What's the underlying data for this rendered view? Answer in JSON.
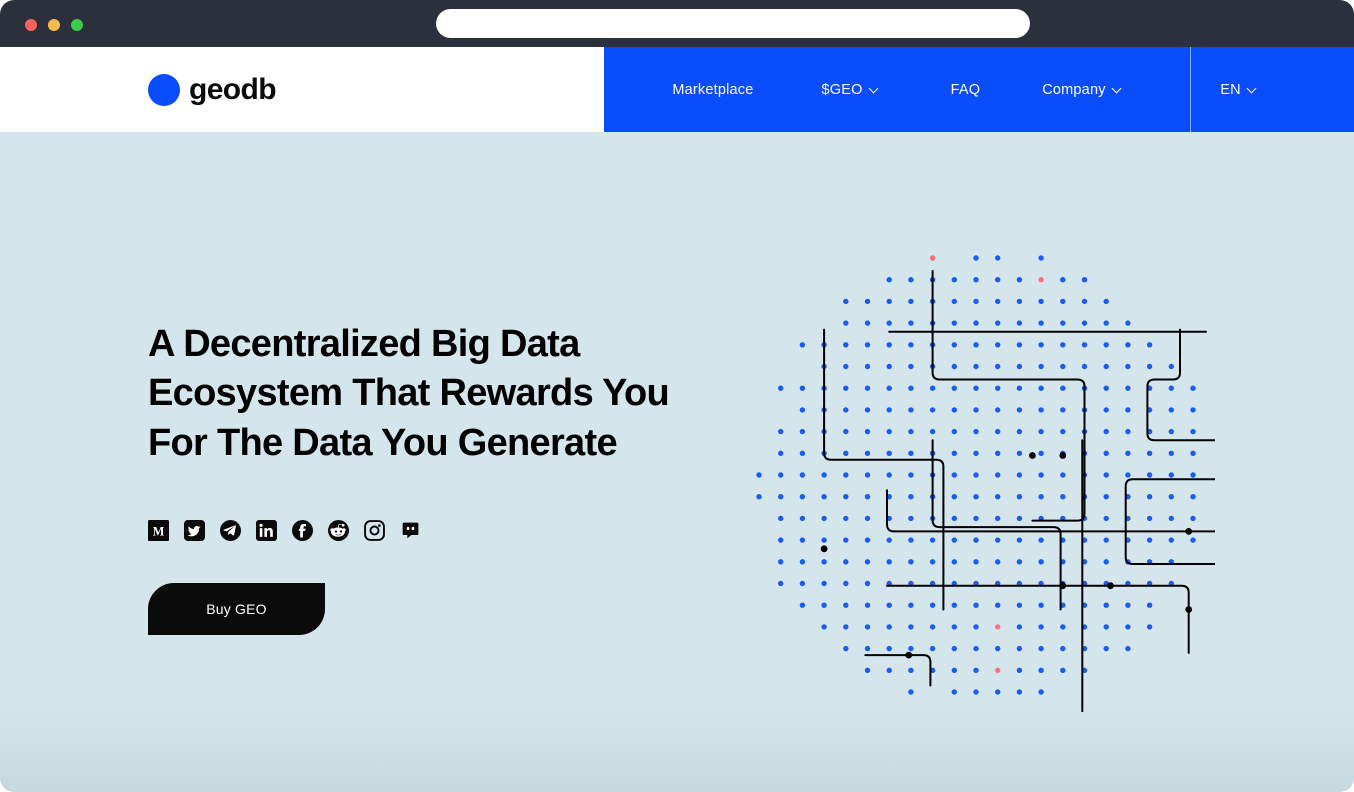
{
  "browser": {
    "traffic_lights": [
      "close",
      "minimize",
      "maximize"
    ],
    "address_value": "",
    "address_placeholder": "",
    "chrome_color": "#2b303c"
  },
  "header": {
    "logo_text": "geodb",
    "logo_mark_color": "#0a4dff",
    "nav_bg_color": "#0a4dff",
    "nav_items": [
      {
        "label": "Marketplace",
        "has_caret": false
      },
      {
        "label": "$GEO",
        "has_caret": true
      },
      {
        "label": "FAQ",
        "has_caret": false
      },
      {
        "label": "Company",
        "has_caret": true
      }
    ],
    "language": {
      "label": "EN",
      "has_caret": true
    }
  },
  "hero": {
    "background_color": "#d5e5ec",
    "headline_line1": "A Decentralized Big Data",
    "headline_line2": "Ecosystem That Rewards You",
    "headline_line3": "For The Data You Generate",
    "socials": [
      {
        "name": "medium",
        "label": "Medium"
      },
      {
        "name": "twitter",
        "label": "Twitter"
      },
      {
        "name": "telegram",
        "label": "Telegram"
      },
      {
        "name": "linkedin",
        "label": "LinkedIn"
      },
      {
        "name": "facebook",
        "label": "Facebook"
      },
      {
        "name": "reddit",
        "label": "Reddit"
      },
      {
        "name": "instagram",
        "label": "Instagram"
      },
      {
        "name": "discord",
        "label": "Discord"
      }
    ],
    "cta_label": "Buy GEO",
    "cta_bg_color": "#0b0b0b"
  },
  "illustration": {
    "name": "dot-grid-circuit-graphic",
    "dot_color": "#1a5cf5",
    "accent_dot_color": "#ff6f7e",
    "trace_color": "#000000",
    "grid_spacing": 21.7,
    "dot_radius": 2.7,
    "accent_dots": [
      [
        3,
        3
      ],
      [
        13,
        1
      ],
      [
        8,
        0
      ],
      [
        26,
        15
      ],
      [
        11,
        17
      ],
      [
        20,
        17
      ],
      [
        23,
        12
      ],
      [
        4,
        19
      ],
      [
        11,
        19
      ],
      [
        6,
        21
      ],
      [
        8,
        23
      ],
      [
        14,
        26
      ],
      [
        19,
        21
      ],
      [
        22,
        18
      ]
    ]
  }
}
